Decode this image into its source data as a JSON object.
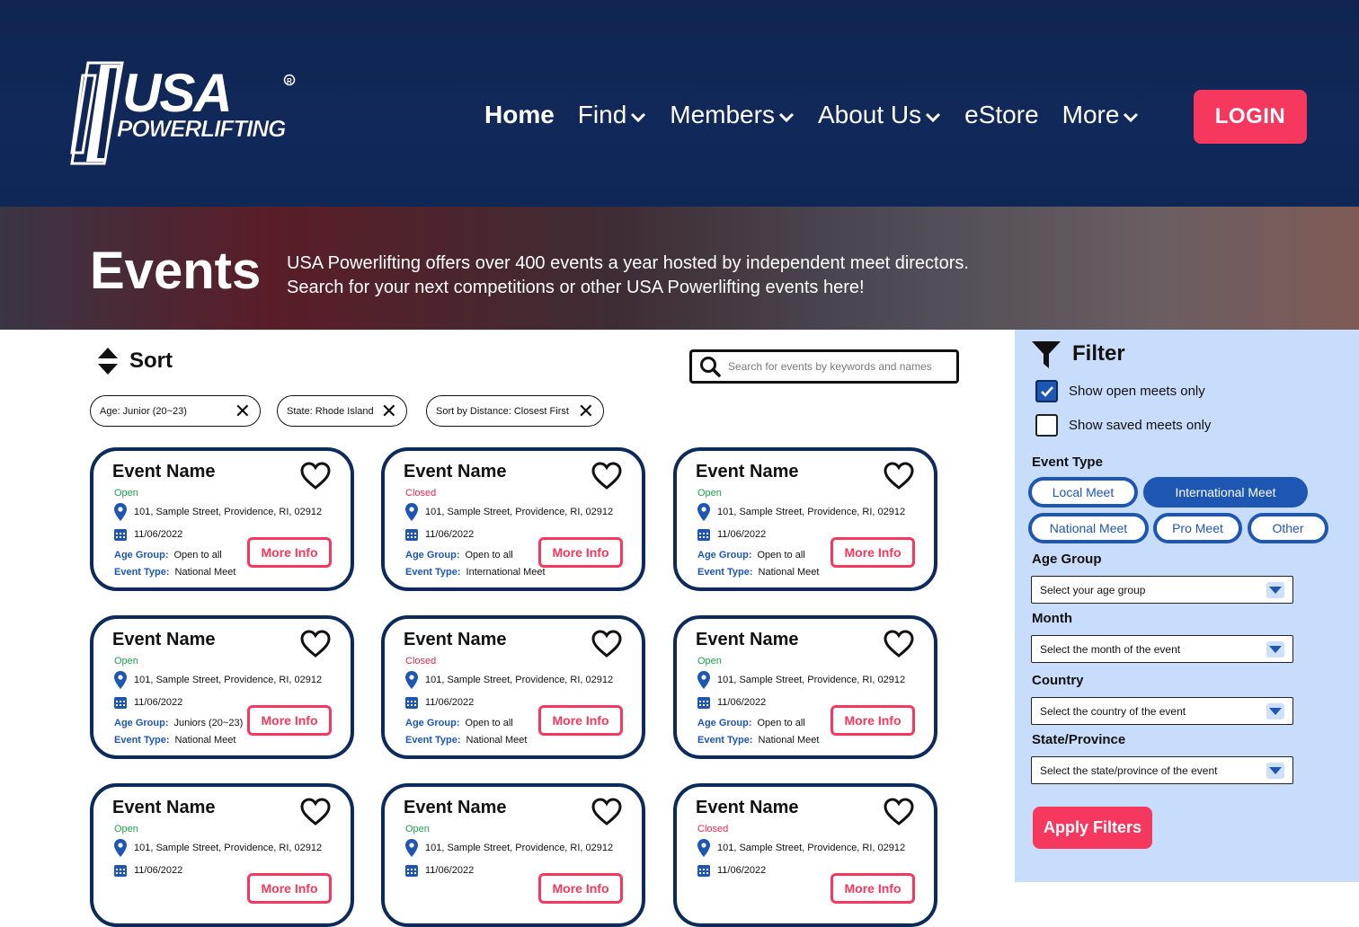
{
  "header": {
    "logo_text": "USA POWERLIFTING",
    "nav": [
      {
        "label": "Home",
        "dropdown": false
      },
      {
        "label": "Find",
        "dropdown": true
      },
      {
        "label": "Members",
        "dropdown": true
      },
      {
        "label": "About Us",
        "dropdown": true
      },
      {
        "label": "eStore",
        "dropdown": false
      },
      {
        "label": "More",
        "dropdown": true
      }
    ],
    "login_label": "LOGIN"
  },
  "hero": {
    "title": "Events",
    "line1": "USA Powerlifting offers over 400 events a year hosted by independent meet directors.",
    "line2": "Search for your next competitions or other USA Powerlifting events here!"
  },
  "sort": {
    "label": "Sort"
  },
  "search": {
    "placeholder": "Search for events by keywords and names"
  },
  "chips": [
    {
      "label": "Age: Junior (20~23)"
    },
    {
      "label": "State: Rhode Island"
    },
    {
      "label": "Sort by Distance: Closest First"
    }
  ],
  "card_labels": {
    "age_group": "Age Group:",
    "event_type": "Event Type:",
    "more_info": "More Info"
  },
  "cards": [
    {
      "name": "Event Name",
      "status": "Open",
      "address": "101, Sample Street, Providence, RI, 02912",
      "date": "11/06/2022",
      "age_group": "Open to all",
      "event_type": "National Meet"
    },
    {
      "name": "Event Name",
      "status": "Closed",
      "address": "101, Sample Street, Providence, RI, 02912",
      "date": "11/06/2022",
      "age_group": "Open to all",
      "event_type": "International Meet"
    },
    {
      "name": "Event Name",
      "status": "Open",
      "address": "101, Sample Street, Providence, RI, 02912",
      "date": "11/06/2022",
      "age_group": "Open to all",
      "event_type": "National Meet"
    },
    {
      "name": "Event Name",
      "status": "Open",
      "address": "101, Sample Street, Providence, RI, 02912",
      "date": "11/06/2022",
      "age_group": "Juniors (20~23)",
      "event_type": "National Meet"
    },
    {
      "name": "Event Name",
      "status": "Closed",
      "address": "101, Sample Street, Providence, RI, 02912",
      "date": "11/06/2022",
      "age_group": "Open to all",
      "event_type": "National Meet"
    },
    {
      "name": "Event Name",
      "status": "Open",
      "address": "101, Sample Street, Providence, RI, 02912",
      "date": "11/06/2022",
      "age_group": "Open to all",
      "event_type": "National Meet"
    },
    {
      "name": "Event Name",
      "status": "Open",
      "address": "101, Sample Street, Providence, RI, 02912",
      "date": "11/06/2022",
      "age_group": "",
      "event_type": ""
    },
    {
      "name": "Event Name",
      "status": "Open",
      "address": "101, Sample Street, Providence, RI, 02912",
      "date": "11/06/2022",
      "age_group": "",
      "event_type": ""
    },
    {
      "name": "Event Name",
      "status": "Closed",
      "address": "101, Sample Street, Providence, RI, 02912",
      "date": "11/06/2022",
      "age_group": "",
      "event_type": ""
    }
  ],
  "filter": {
    "title": "Filter",
    "show_open": {
      "label": "Show open meets only",
      "checked": true
    },
    "show_saved": {
      "label": "Show saved meets only",
      "checked": false
    },
    "event_type_label": "Event Type",
    "event_types": [
      {
        "label": "Local Meet",
        "selected": false
      },
      {
        "label": "International Meet",
        "selected": true
      },
      {
        "label": "National Meet",
        "selected": false
      },
      {
        "label": "Pro Meet",
        "selected": false
      },
      {
        "label": "Other",
        "selected": false
      }
    ],
    "age_group_label": "Age Group",
    "age_group_placeholder": "Select your age group",
    "month_label": "Month",
    "month_placeholder": "Select the month of the event",
    "country_label": "Country",
    "country_placeholder": "Select the country of the event",
    "state_label": "State/Province",
    "state_placeholder": "Select the state/province of the event",
    "apply_label": "Apply Filters"
  },
  "colors": {
    "navy": "#0f2450",
    "accent_red": "#f7385e",
    "blue": "#1d56b3",
    "filter_bg": "#c8dcfb",
    "open_green": "#1ea34a"
  }
}
